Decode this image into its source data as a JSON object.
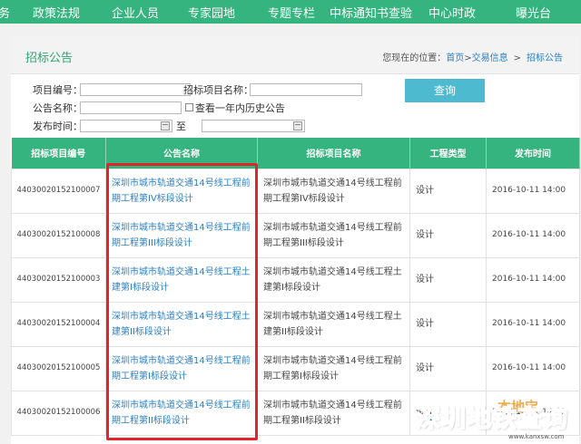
{
  "nav": {
    "items": [
      "务",
      "政策法规",
      "企业人员",
      "专家园地",
      "专题专栏",
      "中标通知书查验",
      "中心时政",
      "曝光台"
    ]
  },
  "header": {
    "title": "招标公告",
    "breadcrumb_prefix": "您现在的位置：",
    "crumbs": [
      "首页",
      "交易信息",
      "招标公告"
    ],
    "sep1": ">",
    "sep2": ">"
  },
  "search": {
    "project_no_label": "项目编号：",
    "project_name_label": "招标项目名称：",
    "notice_name_label": "公告名称：",
    "history_label": "查看一年内历史公告",
    "publish_time_label": "发布时间：",
    "to_label": "至",
    "search_button": "查询"
  },
  "table": {
    "headers": [
      "招标项目编号",
      "公告名称",
      "招标项目名称",
      "工程类型",
      "发布时间"
    ],
    "rows": [
      {
        "code": "44030020152100007",
        "notice": "深圳市城市轨道交通14号线工程前期工程第IV标段设计",
        "project": "深圳市城市轨道交通14号线工程前期工程第IV标段设计",
        "type": "设计",
        "date": "2016-10-11 14:00"
      },
      {
        "code": "44030020152100008",
        "notice": "深圳市城市轨道交通14号线工程前期工程第III标段设计",
        "project": "深圳市城市轨道交通14号线工程前期工程第III标段设计",
        "type": "设计",
        "date": "2016-10-11 14:00"
      },
      {
        "code": "44030020152100003",
        "notice": "深圳市城市轨道交通14号线工程土建第Ⅰ标段设计",
        "project": "深圳市城市轨道交通14号线工程土建第Ⅰ标段设计",
        "type": "设计",
        "date": "2016-10-11 14:00"
      },
      {
        "code": "44030020152100004",
        "notice": "深圳市城市轨道交通14号线工程土建第II标段设计",
        "project": "深圳市城市轨道交通14号线工程土建第II标段设计",
        "type": "设计",
        "date": "2016-10-11 14:00"
      },
      {
        "code": "44030020152100005",
        "notice": "深圳市城市轨道交通14号线工程前期工程第Ⅰ标段设计",
        "project": "深圳市城市轨道交通14号线工程前期工程第Ⅰ标段设计",
        "type": "设计",
        "date": "2016-10-11 14:00"
      },
      {
        "code": "44030020152100006",
        "notice": "深圳市城市轨道交通14号线工程前期工程第II标段设计",
        "project": "深圳市城市轨道交通14号线工程前期工程第II标段设计",
        "type": "设计",
        "date": "2016-10-11 14:00"
      }
    ]
  },
  "watermark": {
    "title": "深圳地铁查询",
    "badge": "本地宝",
    "url": "www.kanxsw.com"
  },
  "colors": {
    "nav_bg": "#35b47f",
    "header_text": "#2fa672",
    "link": "#2a7fc0",
    "button": "#4dbad0",
    "highlight": "#e0262b"
  }
}
